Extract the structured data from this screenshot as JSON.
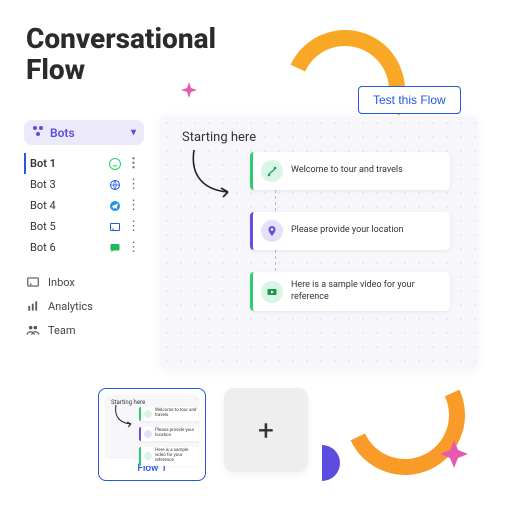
{
  "title_line1": "Conversational",
  "title_line2": "Flow",
  "test_button": "Test this Flow",
  "bots_label": "Bots",
  "bots": [
    {
      "name": "Bot 1",
      "channel": "whatsapp",
      "color": "#25D366"
    },
    {
      "name": "Bot 3",
      "channel": "web",
      "color": "#2558e5"
    },
    {
      "name": "Bot 4",
      "channel": "telegram",
      "color": "#1e96e8"
    },
    {
      "name": "Bot 5",
      "channel": "widget",
      "color": "#2558e5"
    },
    {
      "name": "Bot 6",
      "channel": "chat",
      "color": "#1db954"
    }
  ],
  "nav": {
    "inbox": "Inbox",
    "analytics": "Analytics",
    "team": "Team"
  },
  "canvas": {
    "start_label": "Starting here",
    "nodes": [
      {
        "text": "Welcome to tour and travels",
        "accent": "green",
        "icon": "route"
      },
      {
        "text": "Please provide your location",
        "accent": "purple",
        "icon": "pin"
      },
      {
        "text": "Here is a sample video for your reference",
        "accent": "green",
        "icon": "video"
      }
    ]
  },
  "thumbnail": {
    "label": "Flow 1",
    "start_label": "Starting here"
  },
  "add_label": "+"
}
